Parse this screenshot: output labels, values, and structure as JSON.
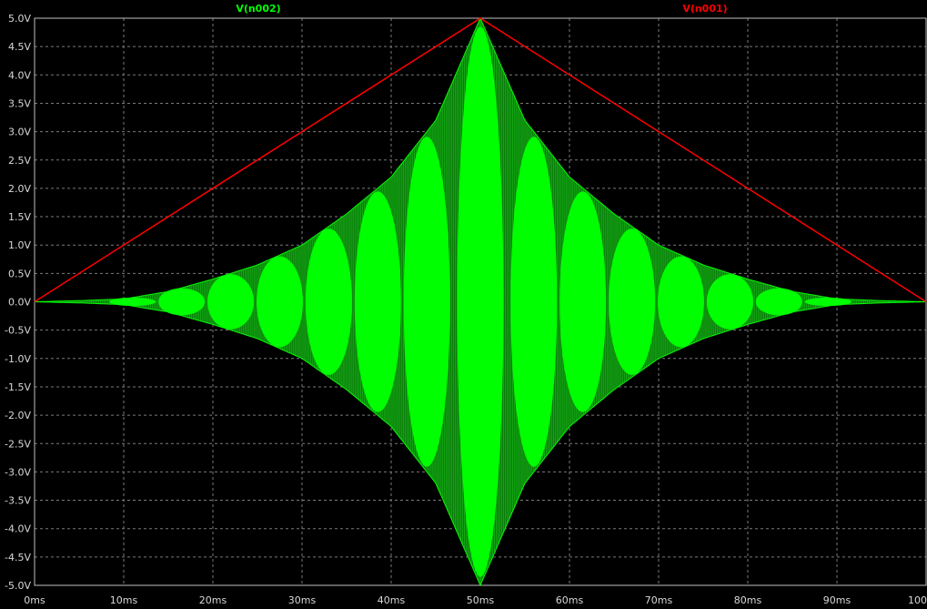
{
  "chart_data": {
    "type": "line",
    "background": "#000000",
    "grid_color": "#7a7a7a",
    "axis_color": "#c0c0c0",
    "tick_label_color": "#d8d8d8",
    "grid": true,
    "x_unit": "ms",
    "y_unit": "V",
    "xlim": [
      0,
      100
    ],
    "ylim": [
      -5.0,
      5.0
    ],
    "xticks": [
      0,
      10,
      20,
      30,
      40,
      50,
      60,
      70,
      80,
      90,
      100
    ],
    "xtick_labels": [
      "0ms",
      "10ms",
      "20ms",
      "30ms",
      "40ms",
      "50ms",
      "60ms",
      "70ms",
      "80ms",
      "90ms",
      "100"
    ],
    "yticks": [
      5.0,
      4.5,
      4.0,
      3.5,
      3.0,
      2.5,
      2.0,
      1.5,
      1.0,
      0.5,
      0.0,
      -0.5,
      -1.0,
      -1.5,
      -2.0,
      -2.5,
      -3.0,
      -3.5,
      -4.0,
      -4.5,
      -5.0
    ],
    "ytick_labels": [
      "5.0V",
      "4.5V",
      "4.0V",
      "3.5V",
      "3.0V",
      "2.5V",
      "2.0V",
      "1.5V",
      "1.0V",
      "0.5V",
      "0.0V",
      "-0.5V",
      "-1.0V",
      "-1.5V",
      "-2.0V",
      "-2.5V",
      "-3.0V",
      "-3.5V",
      "-4.0V",
      "-4.5V",
      "-5.0V"
    ],
    "legend": [
      {
        "name": "V(n002)",
        "color": "#00ff00",
        "position": "top-left"
      },
      {
        "name": "V(n001)",
        "color": "#ff0000",
        "position": "top-right"
      }
    ],
    "series": [
      {
        "name": "V(n001)",
        "color": "#ff0000",
        "style": "line",
        "x": [
          0,
          50,
          100
        ],
        "y": [
          0.0,
          5.0,
          0.0
        ]
      },
      {
        "name": "V(n002)",
        "color": "#00ff00",
        "style": "dense-oscillation",
        "envelope_x": [
          0,
          5,
          10,
          15,
          20,
          25,
          30,
          35,
          40,
          45,
          50,
          55,
          60,
          65,
          70,
          75,
          80,
          85,
          90,
          95,
          100
        ],
        "envelope_y": [
          0.0,
          0.02,
          0.05,
          0.18,
          0.4,
          0.65,
          1.0,
          1.55,
          2.2,
          3.2,
          5.0,
          3.2,
          2.2,
          1.55,
          1.0,
          0.65,
          0.4,
          0.18,
          0.05,
          0.02,
          0.0
        ],
        "beat_peaks_x": [
          11,
          16.5,
          22,
          27.5,
          33,
          38.5,
          44,
          50,
          56,
          61.5,
          67,
          72.5,
          78,
          83.5,
          89
        ]
      }
    ]
  }
}
